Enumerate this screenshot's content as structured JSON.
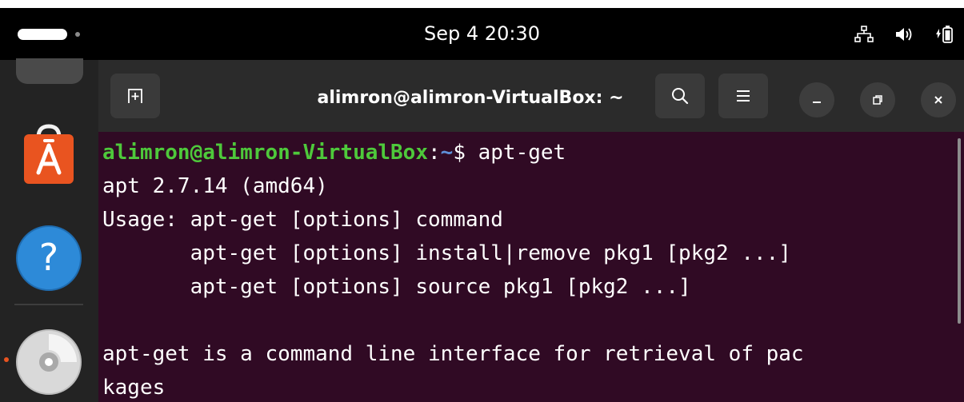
{
  "topbar": {
    "clock": "Sep 4  20:30",
    "icons": [
      "activities-indicator",
      "network-icon",
      "volume-icon",
      "battery-icon"
    ]
  },
  "dock": {
    "apps": [
      "app-center-icon",
      "help-icon",
      "disc-icon"
    ]
  },
  "window": {
    "title": "alimron@alimron-VirtualBox: ~",
    "buttons": [
      "new-tab-icon",
      "search-icon",
      "menu-icon",
      "minimize-icon",
      "maximize-icon",
      "close-icon"
    ]
  },
  "terminal": {
    "prompt": {
      "user_host": "alimron@alimron-VirtualBox",
      "separator": ":",
      "path": "~",
      "symbol": "$",
      "command": " apt-get"
    },
    "lines": [
      "apt 2.7.14 (amd64)",
      "Usage: apt-get [options] command",
      "       apt-get [options] install|remove pkg1 [pkg2 ...]",
      "       apt-get [options] source pkg1 [pkg2 ...]",
      "",
      "apt-get is a command line interface for retrieval of pac",
      "kages"
    ]
  },
  "colors": {
    "terminal_bg": "#300a24",
    "prompt_user": "#4ec93b",
    "prompt_path": "#5e8fd8",
    "headerbar_bg": "#2b2b2b",
    "accent": "#e95420"
  }
}
